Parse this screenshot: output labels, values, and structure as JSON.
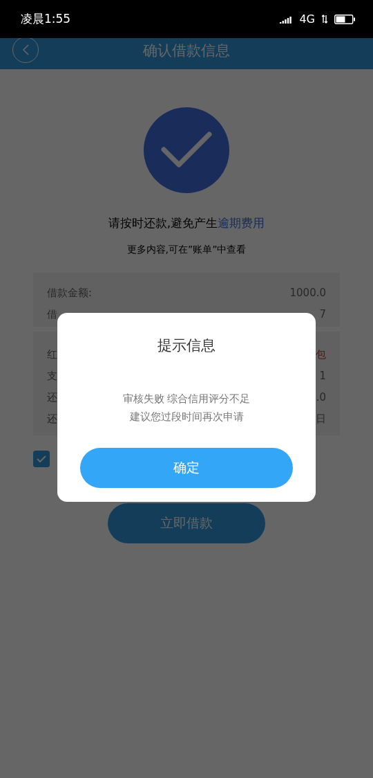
{
  "status_bar": {
    "time": "凌晨1:55",
    "network": "4G"
  },
  "header": {
    "title": "确认借款信息"
  },
  "result": {
    "message": "请按时还款,避免产生",
    "link": "逾期费用",
    "hint": "更多内容,可在”账单”中查看"
  },
  "loan_summary": [
    {
      "label": "借款金额:",
      "value": "1000.0"
    },
    {
      "label": "借",
      "value": "7"
    }
  ],
  "fees": [
    {
      "label": "红",
      "value": "包",
      "kind": "highlight"
    },
    {
      "label": "支",
      "value": "1",
      "kind": "plain"
    },
    {
      "label": "还",
      "value": ".0",
      "kind": "plain"
    },
    {
      "label": "还",
      "value": "日",
      "kind": "plain"
    }
  ],
  "agreement": {
    "checked": true
  },
  "submit_button": "立即借款",
  "dialog": {
    "title": "提示信息",
    "message": [
      "审核失败 综合信用评分不足",
      "建议您过段时间再次申请"
    ],
    "confirm": "确定"
  }
}
